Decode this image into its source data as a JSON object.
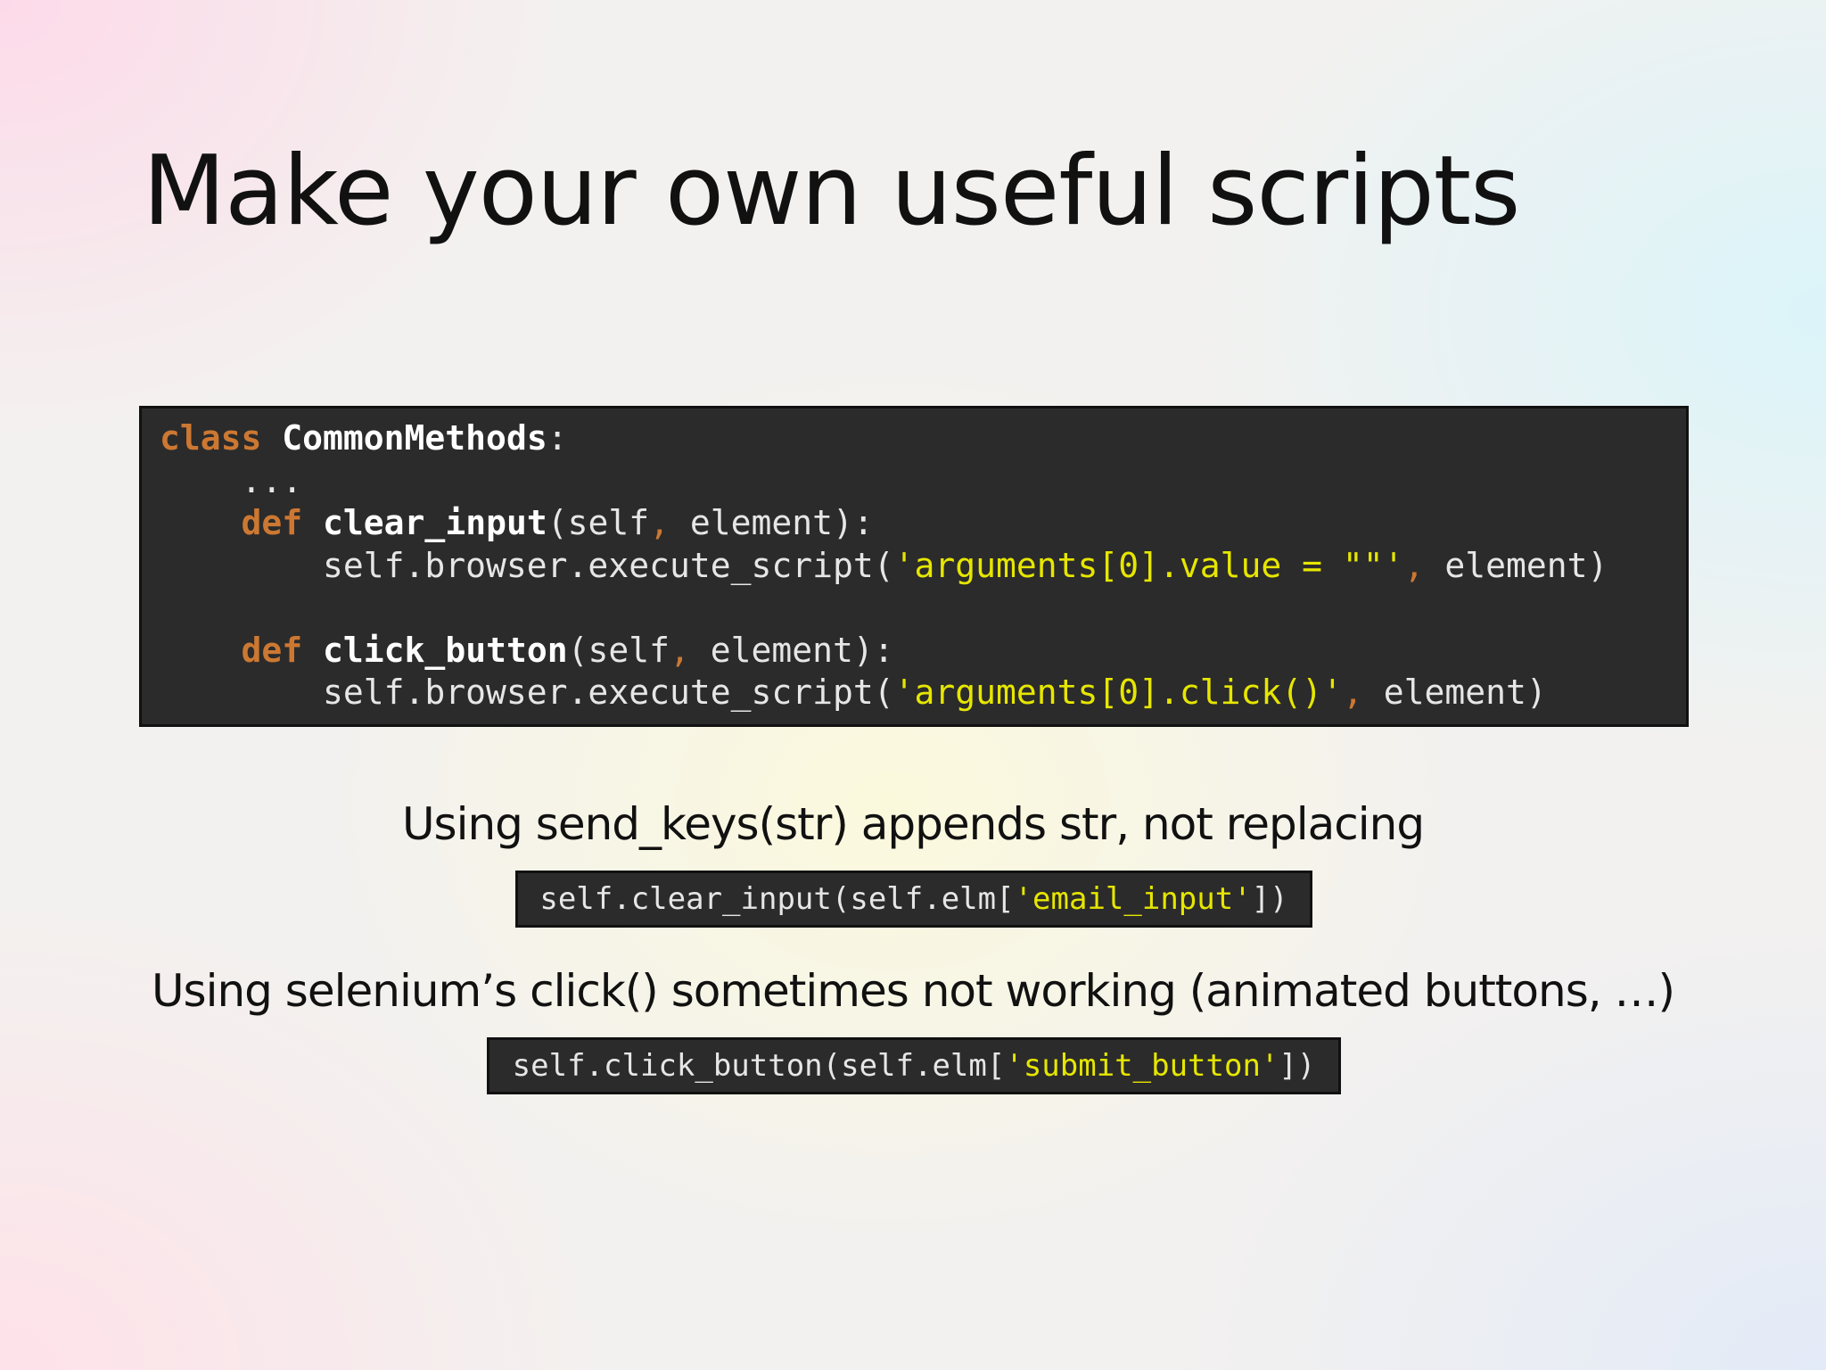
{
  "slide": {
    "title": "Make your own useful scripts"
  },
  "code_block": {
    "lines": [
      [
        {
          "text": "class",
          "style": "kw"
        },
        {
          "text": " ",
          "style": "plain"
        },
        {
          "text": "CommonMethods",
          "style": "fn"
        },
        {
          "text": ":",
          "style": "plain"
        }
      ],
      [
        {
          "text": "    ...",
          "style": "plain"
        }
      ],
      [
        {
          "text": "    ",
          "style": "plain"
        },
        {
          "text": "def",
          "style": "kw"
        },
        {
          "text": " ",
          "style": "plain"
        },
        {
          "text": "clear_input",
          "style": "fn"
        },
        {
          "text": "(self",
          "style": "plain"
        },
        {
          "text": ",",
          "style": "punct"
        },
        {
          "text": " element):",
          "style": "plain"
        }
      ],
      [
        {
          "text": "        self.browser.execute_script(",
          "style": "plain"
        },
        {
          "text": "'arguments[0].value = \"\"'",
          "style": "str"
        },
        {
          "text": ",",
          "style": "punct"
        },
        {
          "text": " element)",
          "style": "plain"
        }
      ],
      [
        {
          "text": " ",
          "style": "plain"
        }
      ],
      [
        {
          "text": "    ",
          "style": "plain"
        },
        {
          "text": "def",
          "style": "kw"
        },
        {
          "text": " ",
          "style": "plain"
        },
        {
          "text": "click_button",
          "style": "fn"
        },
        {
          "text": "(self",
          "style": "plain"
        },
        {
          "text": ",",
          "style": "punct"
        },
        {
          "text": " element):",
          "style": "plain"
        }
      ],
      [
        {
          "text": "        self.browser.execute_script(",
          "style": "plain"
        },
        {
          "text": "'arguments[0].click()'",
          "style": "str"
        },
        {
          "text": ",",
          "style": "punct"
        },
        {
          "text": " element)",
          "style": "plain"
        }
      ]
    ]
  },
  "note_send_keys": {
    "text": "Using send_keys(str) appends str, not replacing",
    "code_before": "self.clear_input(self.elm[",
    "code_string": "'email_input'",
    "code_after": "])"
  },
  "note_click": {
    "text": "Using selenium’s click() sometimes not working (animated buttons, …)",
    "code_before": "self.click_button(self.elm[",
    "code_string": "'submit_button'",
    "code_after": "])"
  }
}
